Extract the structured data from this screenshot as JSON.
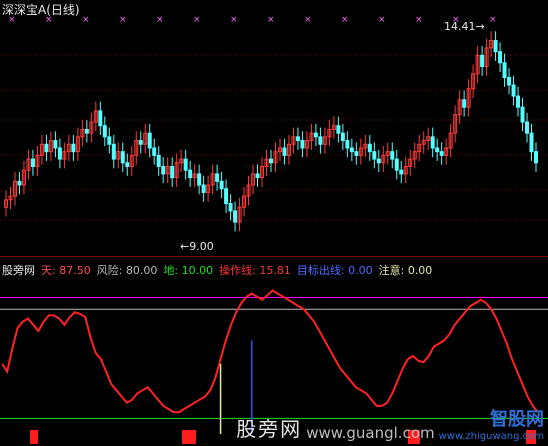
{
  "title": {
    "name": "深深宝A",
    "period": "(日线)"
  },
  "price": {
    "high_label": "14.41",
    "low_label": "9.00"
  },
  "indicator": {
    "name": "股旁网",
    "items": [
      {
        "label": "天:",
        "value": "87.50",
        "color": "#ff4d4d"
      },
      {
        "label": "风险:",
        "value": "80.00",
        "color": "#b9b9b9"
      },
      {
        "label": "地:",
        "value": "10.00",
        "color": "#22dd22"
      },
      {
        "label": "操作线:",
        "value": "15.81",
        "color": "#ff3333"
      },
      {
        "label": "目标出线:",
        "value": "0.00",
        "color": "#4f6bff"
      },
      {
        "label": "注意:",
        "value": "0.00",
        "color": "#e8e8a8"
      }
    ]
  },
  "watermark": {
    "cn": "股旁网",
    "site": "www.guangl.com",
    "brand": "智股网",
    "brand_url": "www.zhiguwang.com"
  },
  "chart_data": [
    {
      "type": "candlestick",
      "title": "深深宝A (日线)",
      "price_range": [
        8.6,
        14.7
      ],
      "marks_count": 14,
      "close": [
        9.9,
        10.0,
        10.4,
        10.3,
        10.7,
        11.0,
        10.8,
        11.1,
        11.4,
        11.2,
        11.5,
        11.3,
        11.0,
        11.2,
        11.4,
        11.2,
        11.6,
        11.8,
        11.7,
        12.0,
        12.3,
        11.9,
        11.6,
        11.4,
        11.0,
        11.2,
        10.9,
        10.8,
        11.1,
        11.5,
        11.4,
        11.7,
        11.3,
        11.1,
        10.8,
        10.6,
        10.8,
        10.5,
        10.9,
        11.0,
        10.7,
        10.5,
        10.6,
        10.3,
        10.1,
        10.3,
        10.6,
        10.4,
        10.2,
        9.8,
        9.6,
        9.3,
        9.7,
        10.0,
        10.3,
        10.6,
        10.5,
        10.8,
        11.0,
        10.9,
        11.2,
        11.3,
        11.1,
        11.4,
        11.6,
        11.5,
        11.3,
        11.5,
        11.7,
        11.6,
        11.4,
        11.6,
        11.8,
        11.9,
        11.7,
        11.5,
        11.3,
        11.2,
        11.1,
        11.3,
        11.4,
        11.2,
        11.0,
        10.9,
        11.1,
        11.2,
        11.0,
        10.7,
        10.6,
        10.8,
        11.0,
        11.2,
        11.4,
        11.5,
        11.6,
        11.3,
        11.2,
        11.1,
        11.3,
        11.7,
        12.2,
        12.6,
        12.4,
        12.9,
        13.3,
        13.8,
        13.5,
        14.0,
        14.2,
        13.9,
        13.6,
        13.2,
        13.0,
        12.7,
        12.4,
        12.0,
        11.7,
        11.2,
        10.9
      ],
      "upper_value": 87.5,
      "lower_value": 10.0
    },
    {
      "type": "line",
      "title": "股旁网",
      "range": [
        0,
        100
      ],
      "horizontal_lines": [
        {
          "name": "天",
          "value": 87.5,
          "color": "#ff00ff"
        },
        {
          "name": "风险",
          "value": 80.0,
          "color": "#b9b9b9"
        },
        {
          "name": "地",
          "value": 10.0,
          "color": "#22dd22"
        }
      ],
      "operation_line": [
        45,
        40,
        55,
        68,
        72,
        74,
        70,
        66,
        72,
        76,
        76,
        74,
        70,
        75,
        78,
        77,
        75,
        62,
        52,
        48,
        40,
        32,
        28,
        24,
        20,
        22,
        26,
        28,
        30,
        26,
        22,
        18,
        16,
        14,
        14,
        16,
        18,
        20,
        22,
        24,
        28,
        36,
        48,
        60,
        70,
        78,
        84,
        88,
        90,
        88,
        86,
        89,
        92,
        90,
        88,
        86,
        84,
        82,
        80,
        76,
        72,
        66,
        60,
        54,
        48,
        42,
        38,
        34,
        30,
        28,
        26,
        22,
        18,
        18,
        20,
        26,
        34,
        42,
        48,
        50,
        47,
        46,
        50,
        56,
        58,
        60,
        64,
        70,
        74,
        78,
        82,
        84,
        86,
        84,
        80,
        74,
        66,
        58,
        48,
        40,
        32,
        24,
        18,
        14
      ],
      "bars": [
        {
          "name": "注意",
          "color": "#e8e8a8",
          "x_index": 16,
          "value": 45
        },
        {
          "name": "目标出线",
          "color": "#3352ff",
          "x_index": 18,
          "value": 60
        }
      ]
    }
  ]
}
